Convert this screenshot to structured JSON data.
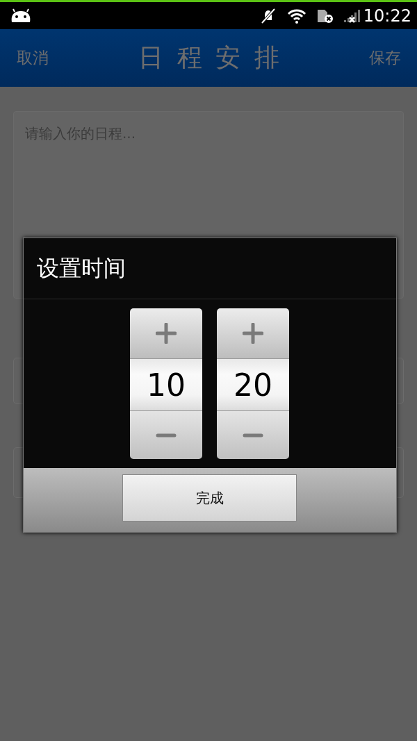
{
  "status_bar": {
    "time": "10:22"
  },
  "header": {
    "cancel": "取消",
    "title": "日程安排",
    "save": "保存"
  },
  "form": {
    "note_field": {
      "placeholder": "请输入你的日程..."
    }
  },
  "dialog": {
    "title": "设置时间",
    "pickers": [
      {
        "value": "10"
      },
      {
        "value": "20"
      }
    ],
    "done": "完成"
  }
}
